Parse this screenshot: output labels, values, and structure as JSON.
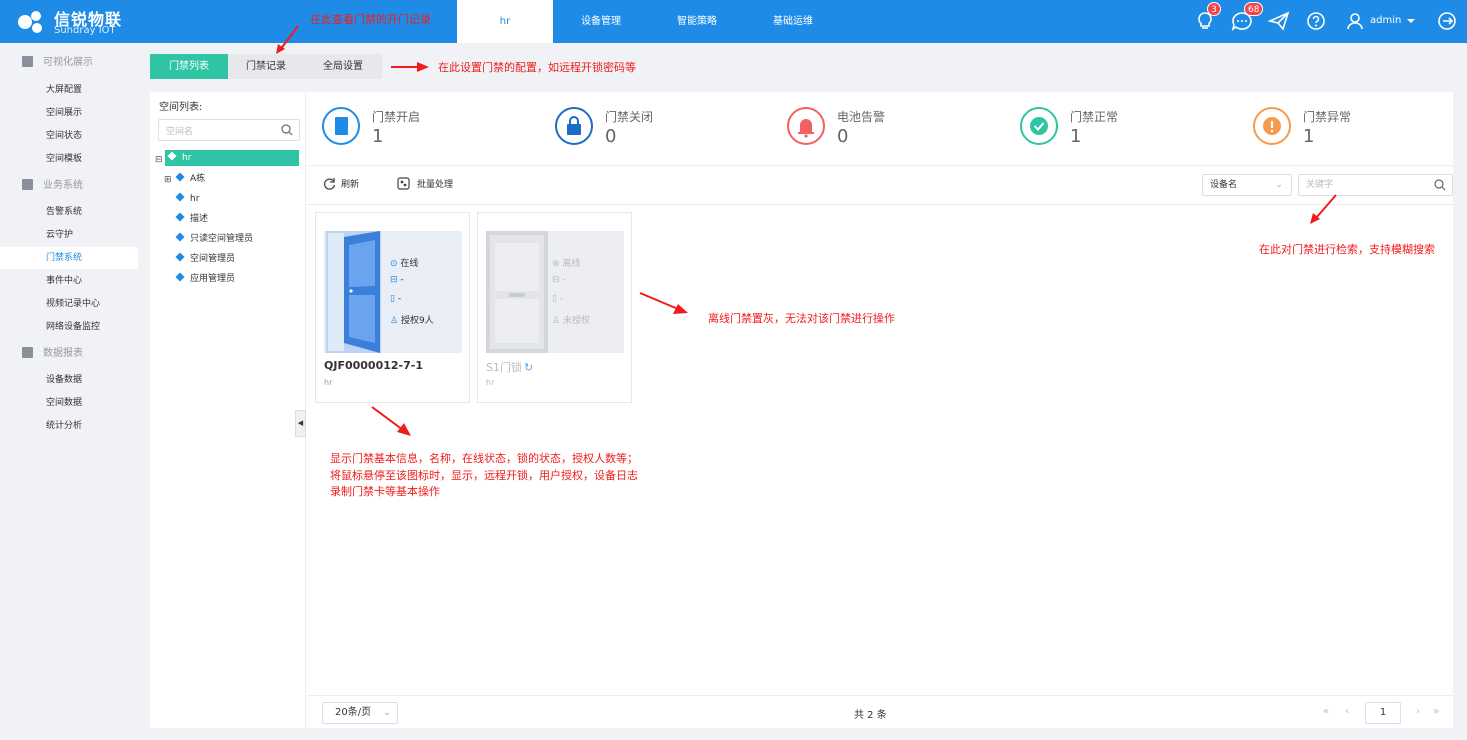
{
  "brand": {
    "name_cn": "信锐物联",
    "name_en": "Sundray IOT"
  },
  "topnav": {
    "items": [
      "hr",
      "设备管理",
      "智能策略",
      "基础运维"
    ],
    "active": "hr"
  },
  "notifications": {
    "bulb_count": "3",
    "message_count": "68"
  },
  "user": {
    "name": "admin"
  },
  "sidebar": {
    "groups": [
      {
        "label": "可视化展示",
        "items": [
          "大屏配置",
          "空间展示",
          "空间状态",
          "空间模板"
        ]
      },
      {
        "label": "业务系统",
        "items": [
          "告警系统",
          "云守护",
          "门禁系统",
          "事件中心",
          "视频记录中心",
          "网络设备监控"
        ]
      },
      {
        "label": "数据报表",
        "items": [
          "设备数据",
          "空间数据",
          "统计分析"
        ]
      }
    ],
    "active": "门禁系统"
  },
  "tabs": [
    "门禁列表",
    "门禁记录",
    "全局设置"
  ],
  "annotations": {
    "records": "在此查看门禁的开门记录",
    "settings": "在此设置门禁的配置，如远程开锁密码等",
    "search": "在此对门禁进行检索，支持模糊搜索",
    "offline": "离线门禁置灰，无法对该门禁进行操作",
    "info_1": "显示门禁基本信息，名称，在线状态，锁的状态，授权人数等；",
    "info_2": "将鼠标悬停至该图标时，显示，远程开锁，用户授权，设备日志",
    "info_3": "录制门禁卡等基本操作"
  },
  "tree": {
    "title": "空间列表:",
    "search_placeholder": "空间名",
    "root": "hr",
    "nodes": [
      "A栋",
      "hr",
      "描述",
      "只读空间管理员",
      "空间管理员",
      "应用管理员"
    ]
  },
  "stats": [
    {
      "label": "门禁开启",
      "value": "1",
      "color": "#1e8ce7"
    },
    {
      "label": "门禁关闭",
      "value": "0",
      "color": "#1e6bc4"
    },
    {
      "label": "电池告警",
      "value": "0",
      "color": "#f26161"
    },
    {
      "label": "门禁正常",
      "value": "1",
      "color": "#2fc5a4"
    },
    {
      "label": "门禁异常",
      "value": "1",
      "color": "#f59a4f"
    }
  ],
  "toolbar": {
    "refresh": "刷新",
    "batch": "批量处理",
    "select": "设备名",
    "keyword_placeholder": "关键字"
  },
  "cards": [
    {
      "name": "QJF0000012-7-1",
      "space": "hr",
      "status": "在线",
      "lock": "-",
      "battery": "-",
      "auth": "授权9人"
    },
    {
      "name": "S1门锁",
      "space": "hr",
      "status": "离线",
      "lock": "-",
      "battery": "-",
      "auth": "未授权"
    }
  ],
  "pagination": {
    "page_size": "20条/页",
    "total": "共 2 条",
    "current": "1"
  }
}
